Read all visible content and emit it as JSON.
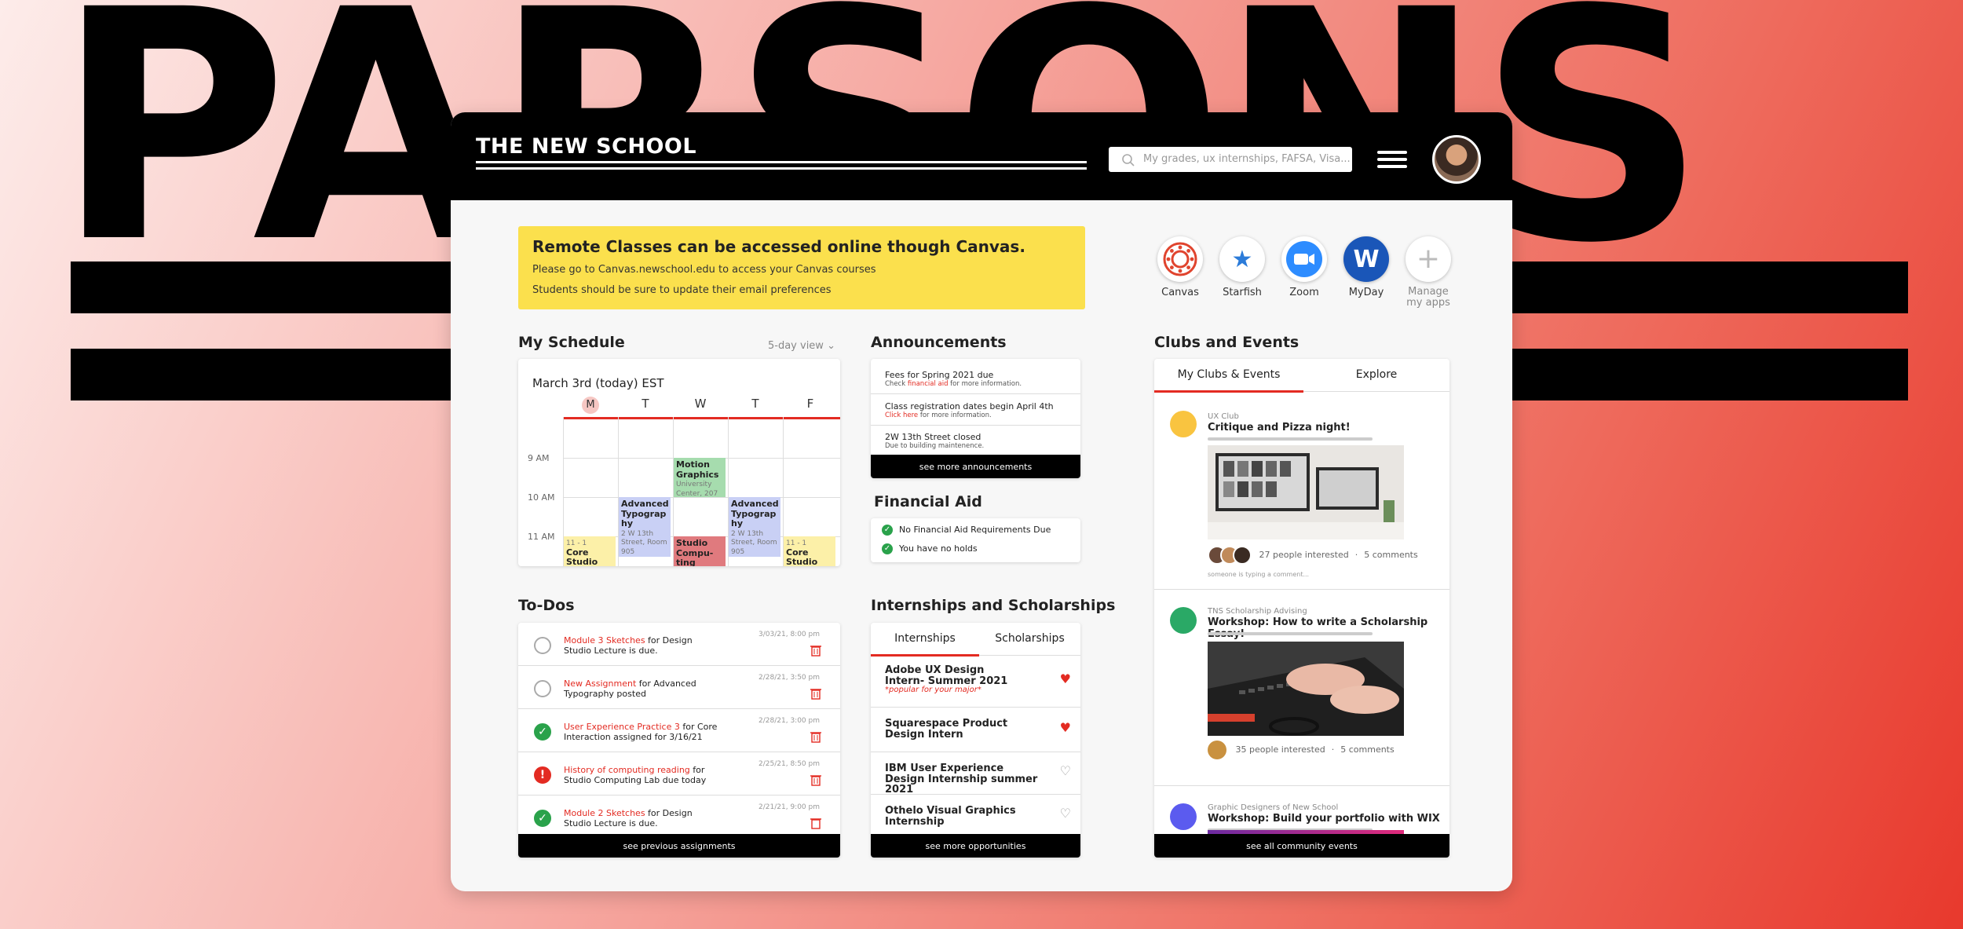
{
  "background_word": "PARSONS",
  "header": {
    "logo": "THE NEW SCHOOL",
    "search_placeholder": "My grades, ux internships, FAFSA, Visa..."
  },
  "banner": {
    "title": "Remote Classes can be accessed online though Canvas.",
    "line1": "Please go to Canvas.newschool.edu to access your Canvas courses",
    "line2": "Students should be sure to update their email preferences"
  },
  "apps": [
    {
      "label": "Canvas",
      "icon": "canvas-icon"
    },
    {
      "label": "Starfish",
      "icon": "starfish-icon"
    },
    {
      "label": "Zoom",
      "icon": "zoom-icon"
    },
    {
      "label": "MyDay",
      "icon": "myday-icon"
    },
    {
      "label": "Manage my apps",
      "icon": "plus-icon"
    }
  ],
  "schedule": {
    "title": "My Schedule",
    "view": "5-day view",
    "date": "March 3rd (today) EST",
    "days": [
      "M",
      "T",
      "W",
      "T",
      "F"
    ],
    "times": [
      "9 AM",
      "10 AM",
      "11 AM"
    ],
    "events": [
      {
        "title": "Motion Graphics",
        "loc": "University Center, 207"
      },
      {
        "title": "Advanced Typograp hy",
        "loc": "2 W 13th Street, Room 905"
      },
      {
        "title": "Advanced Typograp hy",
        "loc": "2 W 13th Street, Room 905"
      },
      {
        "title": "Core Studio",
        "time": "11 - 1"
      },
      {
        "title": "Studio Compu- ting",
        "loc": ""
      },
      {
        "title": "Core Studio",
        "time": "11 - 1"
      }
    ]
  },
  "announcements": {
    "title": "Announcements",
    "items": [
      {
        "title": "Fees for Spring 2021 due",
        "pre": "Check ",
        "link": "financial aid",
        "post": " for more information."
      },
      {
        "title": "Class registration dates begin April 4th",
        "pre": "",
        "link": "Click here",
        "post": " for more information."
      },
      {
        "title": "2W 13th Street closed",
        "pre": "Due to building maintenence.",
        "link": "",
        "post": ""
      }
    ],
    "footer": "see more announcements"
  },
  "financial_aid": {
    "title": "Financial Aid",
    "items": [
      "No Financial Aid Requirements Due",
      "You have no holds"
    ]
  },
  "todos": {
    "title": "To-Dos",
    "items": [
      {
        "link": "Module 3 Sketches",
        "text": " for Design Studio Lecture is due.",
        "date": "3/03/21, 8:00 pm",
        "status": "open"
      },
      {
        "link": "New Assignment",
        "text": " for Advanced Typography posted",
        "date": "2/28/21, 3:50 pm",
        "status": "open"
      },
      {
        "link": "User Experience Practice 3",
        "text": " for Core Interaction assigned for 3/16/21",
        "date": "2/28/21, 3:00 pm",
        "status": "done"
      },
      {
        "link": "History of computing reading",
        "text": " for Studio Computing Lab due today",
        "date": "2/25/21, 8:50 pm",
        "status": "alert"
      },
      {
        "link": "Module 2 Sketches",
        "text": " for Design Studio Lecture is due.",
        "date": "2/21/21, 9:00 pm",
        "status": "done"
      }
    ],
    "footer": "see previous assignments"
  },
  "internships": {
    "title": "Internships and Scholarships",
    "tabs": [
      "Internships",
      "Scholarships"
    ],
    "items": [
      {
        "title": "Adobe UX Design Intern- Summer 2021",
        "note": "*popular for your major*",
        "liked": true
      },
      {
        "title": "Squarespace Product Design Intern",
        "note": "",
        "liked": true
      },
      {
        "title": "IBM User Experience Design Internship summer 2021",
        "note": "",
        "liked": false
      },
      {
        "title": "Othelo Visual Graphics Internship",
        "note": "",
        "liked": false
      }
    ],
    "footer": "see more opportunities"
  },
  "clubs": {
    "title": "Clubs and Events",
    "tabs": [
      "My Clubs & Events",
      "Explore"
    ],
    "items": [
      {
        "org": "UX Club",
        "name": "Critique and Pizza night!",
        "interested": "27 people interested",
        "comments": "5 comments",
        "typing": "someone is typing a comment...",
        "color": "#f9c440"
      },
      {
        "org": "TNS Scholarship Advising",
        "name": "Workshop: How to write a Scholarship Essay!",
        "interested": "35 people interested",
        "comments": "5 comments",
        "color": "#2aa966"
      },
      {
        "org": "Graphic Designers of New School",
        "name": "Workshop: Build your portfolio with WIX",
        "color": "#5b5bef"
      }
    ],
    "footer": "see all community events"
  },
  "colors": {
    "accent": "#e32b22",
    "banner": "#fbe04d",
    "success": "#2aa24b"
  }
}
